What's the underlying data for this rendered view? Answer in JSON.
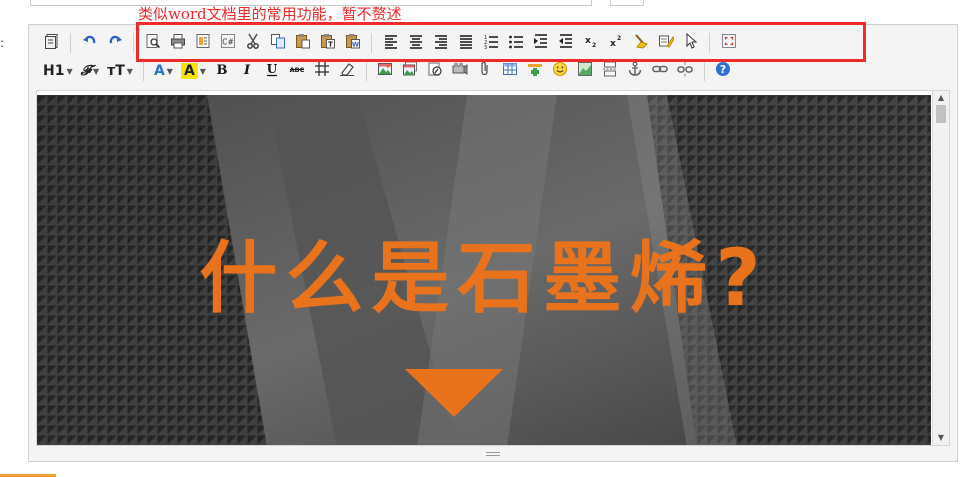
{
  "annotation": {
    "text": "类似word文档里的常用功能，暂不赘述",
    "color": "#ef2a2a"
  },
  "toolbar": {
    "row1": [
      {
        "name": "source-code-icon"
      },
      {
        "sep": true
      },
      {
        "name": "undo-icon"
      },
      {
        "name": "redo-icon"
      },
      {
        "sep": true
      },
      {
        "name": "preview-icon"
      },
      {
        "name": "print-icon"
      },
      {
        "name": "template-icon"
      },
      {
        "name": "code-csharp-icon",
        "label": "C#"
      },
      {
        "name": "cut-icon"
      },
      {
        "name": "copy-icon"
      },
      {
        "name": "paste-icon"
      },
      {
        "name": "paste-text-icon",
        "label": "T"
      },
      {
        "name": "paste-word-icon",
        "label": "W"
      },
      {
        "sep": true
      },
      {
        "name": "align-left-icon"
      },
      {
        "name": "align-center-icon"
      },
      {
        "name": "align-right-icon"
      },
      {
        "name": "align-justify-icon"
      },
      {
        "name": "ordered-list-icon"
      },
      {
        "name": "unordered-list-icon"
      },
      {
        "name": "indent-icon"
      },
      {
        "name": "outdent-icon"
      },
      {
        "name": "subscript-icon",
        "label": "x₂"
      },
      {
        "name": "superscript-icon",
        "label": "x²"
      },
      {
        "name": "clear-format-icon"
      },
      {
        "name": "format-painter-icon"
      },
      {
        "name": "select-all-icon"
      },
      {
        "sep": true
      },
      {
        "name": "fullscreen-icon"
      }
    ],
    "row2": [
      {
        "name": "heading-dropdown",
        "label": "H1"
      },
      {
        "name": "font-family-dropdown",
        "label": "𝓕"
      },
      {
        "name": "font-size-dropdown",
        "label": "тT"
      },
      {
        "sep": true
      },
      {
        "name": "font-color-dropdown",
        "label": "A"
      },
      {
        "name": "highlight-color-dropdown",
        "label": "A"
      },
      {
        "name": "bold-icon",
        "label": "B"
      },
      {
        "name": "italic-icon",
        "label": "I"
      },
      {
        "name": "underline-icon",
        "label": "U"
      },
      {
        "name": "strikethrough-icon",
        "label": "ABC"
      },
      {
        "name": "line-height-icon"
      },
      {
        "name": "eraser-icon"
      },
      {
        "sep": true
      },
      {
        "name": "image-icon"
      },
      {
        "name": "multi-image-icon"
      },
      {
        "name": "flash-icon"
      },
      {
        "name": "media-icon"
      },
      {
        "name": "attachment-icon"
      },
      {
        "name": "table-icon"
      },
      {
        "name": "horizontal-rule-icon"
      },
      {
        "name": "emoticon-icon"
      },
      {
        "name": "map-icon"
      },
      {
        "name": "page-break-icon"
      },
      {
        "name": "anchor-icon"
      },
      {
        "name": "link-icon"
      },
      {
        "name": "unlink-icon"
      },
      {
        "sep": true
      },
      {
        "name": "help-icon",
        "label": "?"
      }
    ]
  },
  "content": {
    "banner_title": "什么是石墨烯?",
    "banner_text_color": "#e8731c",
    "banner_bg_color": "#5e5e5e"
  },
  "colors": {
    "accent_orange": "#f0a030",
    "font_color_blue": "#2e6fd0",
    "highlight_yellow": "#ffe100",
    "help_blue": "#2f6fd6"
  }
}
